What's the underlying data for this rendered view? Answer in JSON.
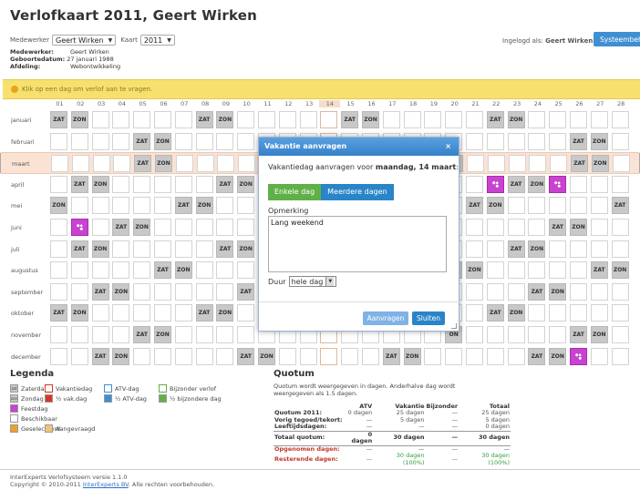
{
  "title": "Verlofkaart 2011, Geert Wirken",
  "selectors": {
    "medewerker_label": "Medewerker",
    "medewerker_value": "Geert Wirken",
    "kaart_label": "Kaart",
    "kaart_value": "2011"
  },
  "user": {
    "medewerker_label": "Medewerker:",
    "medewerker": "Geert Wirken",
    "geboorte_label": "Geboortedatum:",
    "geboorte": "27 januari 1988",
    "afdeling_label": "Afdeling:",
    "afdeling": "Webontwikkeling"
  },
  "login": {
    "prefix": "Ingelogd als:",
    "name": "Geert Wirken"
  },
  "system_button": "Systeembeheer",
  "notice": "Klik op een dag om verlof aan te vragen.",
  "day_numbers": [
    "01",
    "02",
    "03",
    "04",
    "05",
    "06",
    "07",
    "08",
    "09",
    "10",
    "11",
    "12",
    "13",
    "14",
    "15",
    "16",
    "17",
    "18",
    "19",
    "20",
    "21",
    "22",
    "23",
    "24",
    "25",
    "26",
    "27",
    "28"
  ],
  "highlight_day": 14,
  "months": [
    {
      "name": "januari",
      "cells": {
        "1": "ZAT",
        "2": "ZON",
        "8": "ZAT",
        "9": "ZON",
        "15": "ZAT",
        "16": "ZON",
        "22": "ZAT",
        "23": "ZON"
      }
    },
    {
      "name": "februari",
      "cells": {
        "5": "ZAT",
        "6": "ZON",
        "26": "ZAT",
        "27": "ZON"
      }
    },
    {
      "name": "maart",
      "cells": {
        "5": "ZAT",
        "6": "ZON",
        "20": "ON",
        "26": "ZAT",
        "27": "ZON"
      }
    },
    {
      "name": "april",
      "cells": {
        "2": "ZAT",
        "3": "ZON",
        "9": "ZAT",
        "10": "ZON",
        "22": "H",
        "23": "ZAT",
        "24": "ZON",
        "25": "H"
      }
    },
    {
      "name": "mei",
      "cells": {
        "1": "ZON",
        "7": "ZAT",
        "8": "ZON",
        "21": "ZAT",
        "22": "ZON",
        "28": "ZAT"
      }
    },
    {
      "name": "juni",
      "cells": {
        "2": "H",
        "4": "ZAT",
        "5": "ZON",
        "25": "ZAT",
        "26": "ZON"
      }
    },
    {
      "name": "juli",
      "cells": {
        "2": "ZAT",
        "3": "ZON",
        "9": "ZAT",
        "10": "ZON",
        "23": "ZAT",
        "24": "ZON"
      }
    },
    {
      "name": "augustus",
      "cells": {
        "6": "ZAT",
        "7": "ZON",
        "20": "AT",
        "21": "ZON",
        "27": "ZAT",
        "28": "ZON"
      }
    },
    {
      "name": "september",
      "cells": {
        "3": "ZAT",
        "4": "ZON",
        "10": "ZAT",
        "24": "ZAT",
        "25": "ZON"
      }
    },
    {
      "name": "oktober",
      "cells": {
        "1": "ZAT",
        "2": "ZON",
        "8": "ZAT",
        "9": "ZON",
        "22": "ZAT",
        "23": "ZON"
      }
    },
    {
      "name": "november",
      "cells": {
        "5": "ZAT",
        "6": "ZON",
        "20": "ON",
        "26": "ZAT",
        "27": "ZON"
      }
    },
    {
      "name": "december",
      "cells": {
        "3": "ZAT",
        "4": "ZON",
        "10": "ZAT",
        "11": "ZON",
        "17": "ZAT",
        "18": "ZON",
        "24": "ZAT",
        "25": "ZON",
        "26": "H"
      }
    }
  ],
  "legend": {
    "title": "Legenda",
    "items": [
      {
        "label": "Zaterdag",
        "swatch": "#c8c8c8",
        "text": "zat"
      },
      {
        "label": "Zondag",
        "swatch": "#c8c8c8",
        "text": "zon"
      },
      {
        "label": "Feestdag",
        "swatch": "#c843d0",
        "text": ""
      },
      {
        "label": "Beschikbaar",
        "swatch": "#ffffff",
        "text": ""
      },
      {
        "label": "Geselecteerd",
        "swatch": "#f0a030",
        "text": ""
      },
      {
        "label": "Vakantiedag",
        "swatch": "#ffffff",
        "border": "#d9342b",
        "text": ""
      },
      {
        "label": "½ vak.dag",
        "swatch": "#d9342b",
        "text": ""
      },
      {
        "label": "Aangevraagd",
        "swatch": "#f3c27a",
        "text": ""
      },
      {
        "label": "ATV-dag",
        "swatch": "#ffffff",
        "border": "#3f8fd2",
        "text": ""
      },
      {
        "label": "½ ATV-dag",
        "swatch": "#3f8fd2",
        "text": ""
      },
      {
        "label": "Bijzonder verlof",
        "swatch": "#ffffff",
        "border": "#5fb046",
        "text": ""
      },
      {
        "label": "½ bijzondere dag",
        "swatch": "#5fb046",
        "text": ""
      }
    ]
  },
  "quotum": {
    "title": "Quotum",
    "description": "Quotum wordt weergegeven in dagen. Anderhalve dag wordt weergegeven als 1.5 dagen.",
    "headers": [
      "",
      "ATV",
      "Vakantie",
      "Bijzonder",
      "Totaal"
    ],
    "rows": [
      [
        "Quotum 2011:",
        "0 dagen",
        "25 dagen",
        "—",
        "25 dagen"
      ],
      [
        "Vorig tegoed/tekort:",
        "—",
        "5 dagen",
        "—",
        "5 dagen"
      ],
      [
        "Leeftijdsdagen:",
        "—",
        "—",
        "—",
        "0 dagen"
      ],
      [
        "Totaal quotum:",
        "0 dagen",
        "30 dagen",
        "—",
        "30 dagen"
      ],
      [
        "Opgenomen dagen:",
        "—",
        "—",
        "—",
        "—"
      ],
      [
        "Resterende dagen:",
        "—",
        "30 dagen (100%)",
        "—",
        "30 dagen (100%)"
      ]
    ]
  },
  "footer": {
    "line1": "InterExperts Verlofsysteem versie 1.1.0",
    "line2a": "Copyright © 2010-2011 ",
    "line2link": "InterExperts BV",
    "line2b": ". Alle rechten voorbehouden."
  },
  "modal": {
    "title": "Vakantie aanvragen",
    "close": "×",
    "question_prefix": "Vakantiedag aanvragen voor ",
    "question_date": "maandag, 14 maart",
    "question_suffix": ":",
    "tab_single": "Enkele dag",
    "tab_multi": "Meerdere dagen",
    "remark_label": "Opmerking",
    "remark_value": "Lang weekend",
    "duur_label": "Duur",
    "duur_value": "hele dag",
    "submit": "Aanvragen",
    "close_button": "Sluiten"
  }
}
